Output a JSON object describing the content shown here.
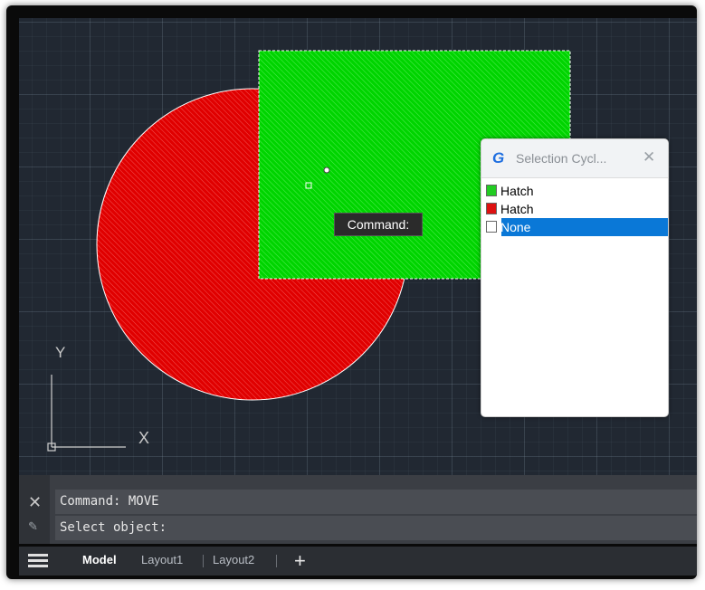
{
  "viewport": {
    "background": "#212832",
    "axis_y_label": "Y",
    "axis_x_label": "X",
    "command_tooltip": "Command:"
  },
  "shapes": {
    "circle_fill": "#e00000",
    "rectangle_fill": "#00d800",
    "selection_outline": "#ffffff"
  },
  "dialog": {
    "title": "Selection Cycl...",
    "close_glyph": "✕",
    "logo_glyph": "G",
    "items": [
      {
        "label": "Hatch",
        "color": "#22cc22",
        "selected": false
      },
      {
        "label": "Hatch",
        "color": "#dd1111",
        "selected": false
      },
      {
        "label": "None",
        "color": "#ffffff",
        "selected": true
      }
    ]
  },
  "command_line": {
    "history": "Command: MOVE",
    "prompt": "Select object:"
  },
  "tabs": {
    "items": [
      "Model",
      "Layout1",
      "Layout2"
    ],
    "active": "Model",
    "add_glyph": "+"
  }
}
